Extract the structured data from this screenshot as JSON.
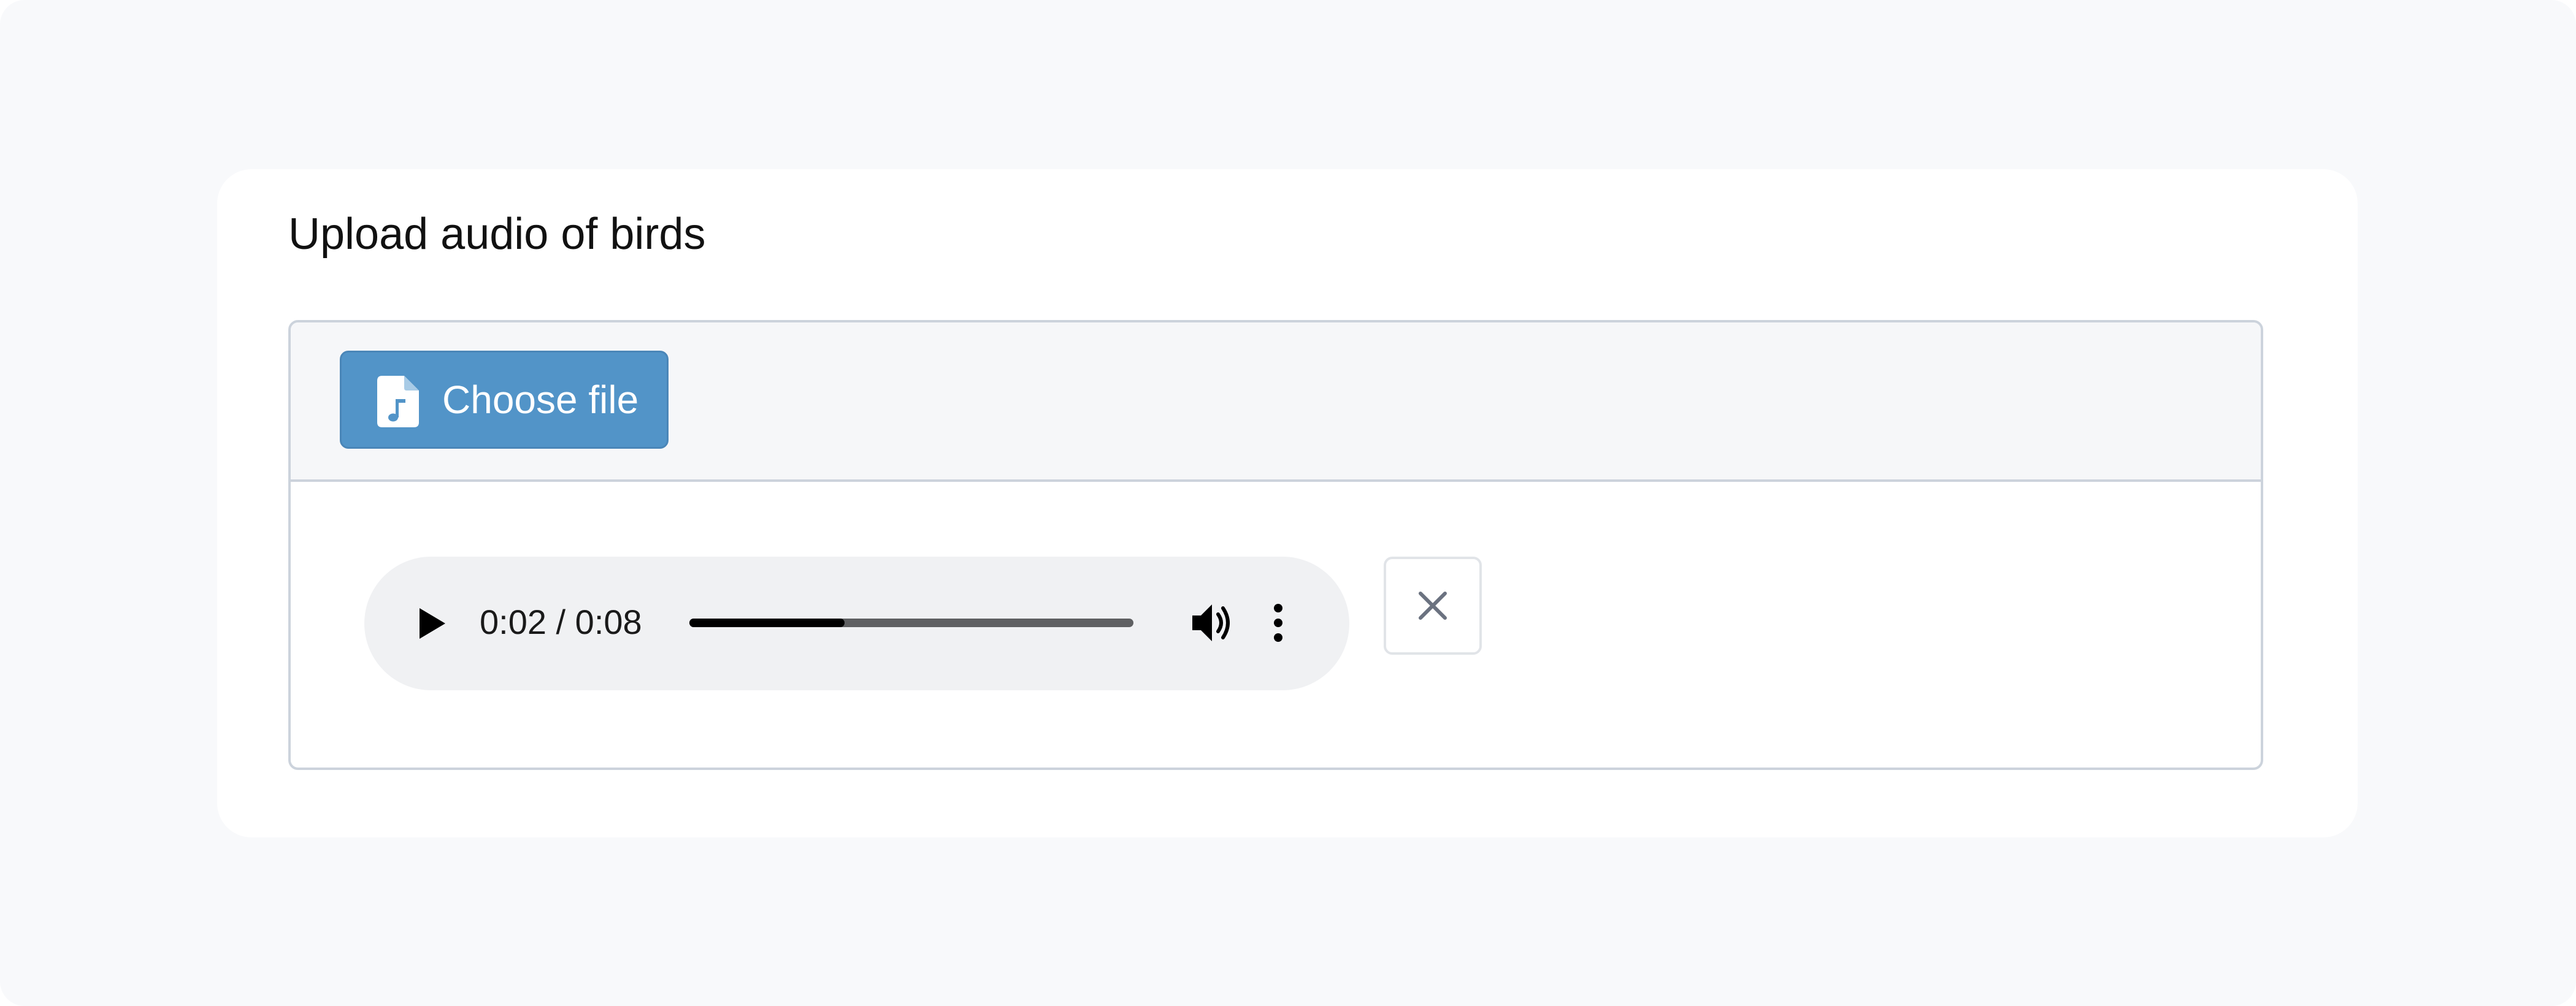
{
  "upload": {
    "title": "Upload audio of birds",
    "choose_file_label": "Choose file",
    "choose_file_icon": "file-music-icon",
    "clear_icon": "close-icon"
  },
  "player": {
    "time_display": "0:02 / 0:08",
    "current_time": "0:02",
    "duration": "0:08",
    "progress_fraction": 0.35,
    "play_icon": "play-icon",
    "volume_icon": "volume-icon",
    "menu_icon": "more-vertical-icon"
  },
  "colors": {
    "page_bg": "#f8f9fb",
    "card_bg": "#ffffff",
    "button_bg": "#5294c8",
    "toolbar_bg": "#f6f7f9",
    "player_bg": "#f0f1f3",
    "border": "#ccd3dc",
    "clear_icon": "#6b7280"
  }
}
